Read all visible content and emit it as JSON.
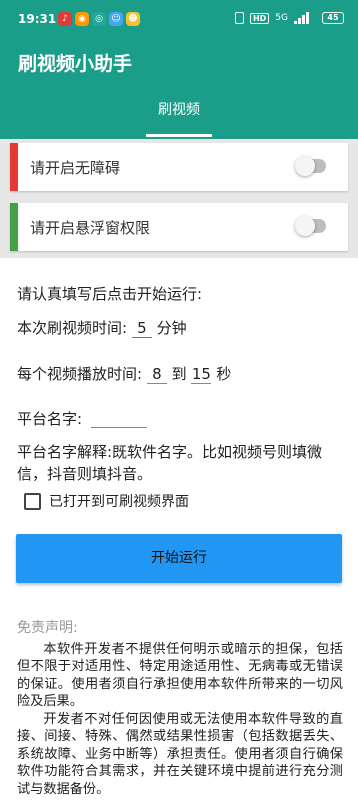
{
  "status_bar": {
    "time": "19:31",
    "notification_icons": [
      "music-app-icon",
      "weibo-icon",
      "camera-app-icon",
      "face-app-icon",
      "game-app-icon"
    ],
    "hd_label": "HD",
    "network_label": "5G",
    "battery": "45"
  },
  "app": {
    "title": "刷视频小助手",
    "tab": "刷视频"
  },
  "permissions": [
    {
      "label": "请开启无障碍",
      "enabled": false,
      "accent": "#e53935"
    },
    {
      "label": "请开启悬浮窗权限",
      "enabled": false,
      "accent": "#43a047"
    }
  ],
  "form": {
    "intro": "请认真填写后点击开始运行:",
    "duration_label": "本次刷视频时间:",
    "duration_value": "5",
    "duration_unit": "分钟",
    "play_label": "每个视频播放时间:",
    "play_min": "8",
    "play_to": "到",
    "play_max": "15",
    "play_unit": "秒",
    "platform_label": "平台名字:",
    "platform_value": "",
    "platform_help": "平台名字解释:既软件名字。比如视频号则填微信，抖音则填抖音。",
    "checkbox_label": "已打开到可刷视频界面",
    "checkbox_checked": false,
    "start_button": "开始运行"
  },
  "disclaimer": {
    "title": "免责声明:",
    "para1": "本软件开发者不提供任何明示或暗示的担保，包括但不限于对适用性、特定用途适用性、无病毒或无错误的保证。使用者须自行承担使用本软件所带来的一切风险及后果。",
    "para2": "开发者不对任何因使用或无法使用本软件导致的直接、间接、特殊、偶然或结果性损害（包括数据丢失、系统故障、业务中断等）承担责任。使用者须自行确保软件功能符合其需求，并在关键环境中提前进行充分测试与数据备份。"
  },
  "colors": {
    "primary": "#1a9e8a",
    "button": "#2196f3"
  }
}
